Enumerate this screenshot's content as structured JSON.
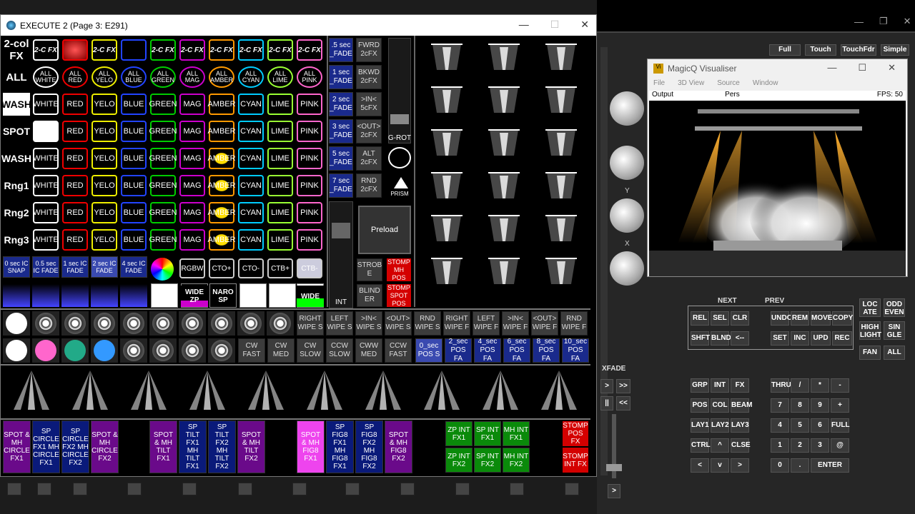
{
  "execute": {
    "title": "EXECUTE 2 (Page 3:  E291)",
    "row_labels": [
      "2-col FX",
      "ALL",
      "WASH",
      "SPOT",
      "WASH",
      "Rng1",
      "Rng2",
      "Rng3"
    ],
    "fx_buttons": [
      "2-C FX",
      "",
      "2-C FX",
      "",
      "2-C FX",
      "2-C FX",
      "2-C FX",
      "2-C FX",
      "2-C FX",
      "2-C FX"
    ],
    "all_buttons": [
      "ALL WHITE",
      "ALL RED",
      "ALL YELO",
      "ALL BLUE",
      "ALL GREEN",
      "ALL MAG",
      "ALL AMBER",
      "ALL CYAN",
      "ALL LIME",
      "ALL PINK"
    ],
    "colour_buttons": [
      "WHITE",
      "RED",
      "YELO",
      "BLUE",
      "GREEN",
      "MAG",
      "AMBER",
      "CYAN",
      "LIME",
      "PINK"
    ],
    "fade_row": [
      "0 sec IC SNAP",
      "0.5 sec IC FADE",
      "1 sec IC FADE",
      "2 sec IC FADE",
      "4 sec IC FADE"
    ],
    "cto_row": [
      "RGBW",
      "CTO+",
      "CTO-",
      "CTB+",
      "CTB-"
    ],
    "beam_row": [
      "WIDE ZP",
      "NARO SP",
      "WIDE"
    ],
    "fade_col": [
      ".5 sec _FADE",
      "1 sec _FADE",
      "2 sec _FADE",
      "3 sec _FADE",
      "5 sec _FADE",
      "7 sec _FADE"
    ],
    "fx_col": [
      "FWRD 2cFX",
      "BKWD 2cFX",
      ">IN< 5cFX",
      "<OUT> 2cFX",
      "ALT 2cFX",
      "RND 2cFX"
    ],
    "grot": "G-ROT",
    "prism": "PRISM",
    "preload": "Preload",
    "int": "INT",
    "strobe": "STROB E",
    "blinder": "BLIND ER",
    "stomp_mh": "STOMP MH POS",
    "stomp_spot": "STOMP SPOT POS",
    "wipe_row": [
      "RIGHT WIPE S",
      "LEFT WIPE S",
      ">IN< WIPE S",
      "<OUT> WIPE S",
      "RND WIPE S",
      "RIGHT WIPE F",
      "LEFT WIPE F",
      ">IN< WIPE F",
      "<OUT> WIPE F",
      "RND WIPE F"
    ],
    "cw_row": [
      "CW FAST",
      "CW MED",
      "CW SLOW",
      "CCW SLOW",
      "CWW MED",
      "CCW FAST"
    ],
    "pos_row": [
      "0_sec POS S",
      "2_sec POS FA",
      "4_sec POS FA",
      "6_sec POS FA",
      "8_sec POS FA",
      "10_sec POS FA"
    ],
    "bottom_purple": [
      "SPOT & MH CIRCLE FX1",
      "SP CIRCLE FX1 MH CIRCLE FX1",
      "SP CIRCLE FX2 MH CIRCLE FX2",
      "SPOT & MH CIRCLE FX2",
      "SPOT & MH TILT FX1",
      "SP TILT FX1 MH TILT FX1",
      "SP TILT FX2 MH TILT FX2",
      "SPOT & MH TILT FX2",
      "SPOT & MH FIG8 FX1",
      "SP FIG8 FX1 MH FIG8 FX1",
      "SP FIG8 FX2 MH FIG8 FX2",
      "SPOT & MH FIG8 FX2"
    ],
    "bottom_green": [
      "ZP INT FX1",
      "SP INT FX1",
      "MH INT FX1",
      "ZP INT FX2",
      "SP INT FX2",
      "MH INT FX2"
    ],
    "stomp_pos_fx": "STOMP POS FX",
    "stomp_int_fx": "STOMP INT FX"
  },
  "top_modes": [
    "Full",
    "Touch",
    "TouchFdr",
    "Simple"
  ],
  "visualiser": {
    "title": "MagicQ Visualiser",
    "menu": [
      "File",
      "3D View",
      "Source",
      "Window"
    ],
    "output": "Output",
    "view": "Pers",
    "fps": "FPS: 50"
  },
  "axis_labels": [
    "Y",
    "X"
  ],
  "xfade": "XFADE",
  "nav": [
    "NEXT",
    "PREV"
  ],
  "keys_left": [
    "REL",
    "SEL",
    "CLR",
    "SHFT",
    "BLND",
    "<--"
  ],
  "keys_mid": [
    "UNDO",
    "REM",
    "MOVE",
    "COPY",
    "SET",
    "INC",
    "UPD",
    "REC"
  ],
  "keys_right": [
    "LOC ATE",
    "ODD EVEN",
    "HIGH LIGHT",
    "SIN GLE",
    "FAN",
    "ALL"
  ],
  "keypad_left": [
    "GRP",
    "INT",
    "FX",
    "POS",
    "COL",
    "BEAM",
    "LAY1",
    "LAY2",
    "LAY3",
    "CTRL",
    "^",
    "CLSE",
    "<",
    "v",
    ">"
  ],
  "keypad_right": [
    "THRU",
    "/",
    "*",
    "-",
    "7",
    "8",
    "9",
    "+",
    "4",
    "5",
    "6",
    "FULL",
    "1",
    "2",
    "3",
    "@",
    "0",
    ".",
    "ENTER"
  ],
  "xfade_btns": [
    ">",
    ">>",
    "||",
    "<<"
  ],
  "bottom_arrow": ">"
}
